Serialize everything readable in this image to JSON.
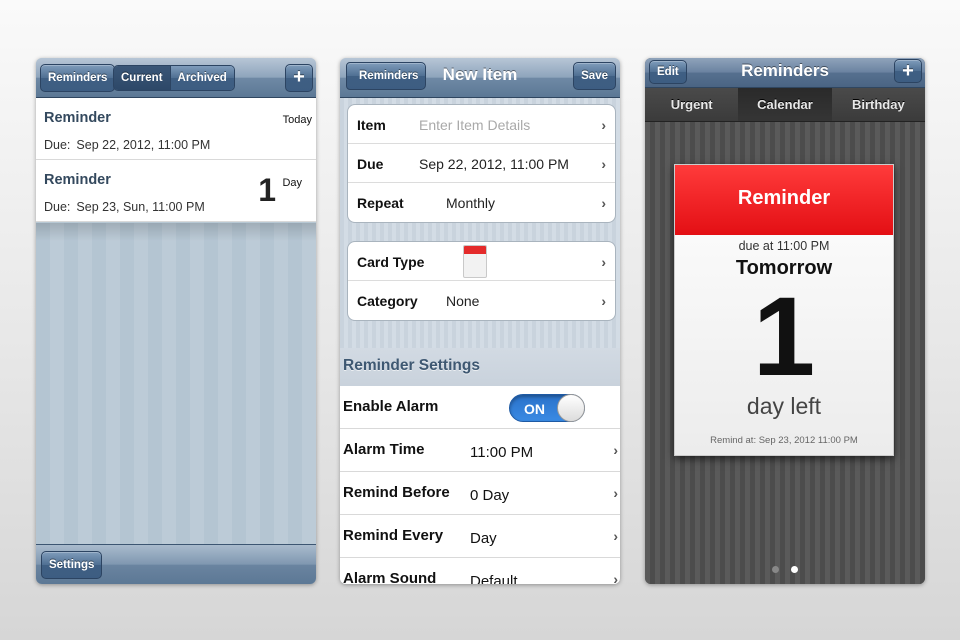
{
  "screen1": {
    "nav": {
      "back_label": "Reminders",
      "seg_current": "Current",
      "seg_archived": "Archived",
      "add_label": "+"
    },
    "items": [
      {
        "title": "Reminder",
        "due_label": "Due:",
        "due_value": "Sep 22, 2012, 11:00 PM",
        "right_text": "Today"
      },
      {
        "title": "Reminder",
        "due_label": "Due:",
        "due_value": "Sep 23, Sun, 11:00 PM",
        "count": "1",
        "unit": "Day"
      }
    ],
    "toolbar": {
      "settings_label": "Settings"
    }
  },
  "screen2": {
    "nav": {
      "back_label": "Reminders",
      "title": "New Item",
      "save_label": "Save"
    },
    "group1": [
      {
        "label": "Item",
        "placeholder": "Enter Item Details"
      },
      {
        "label": "Due",
        "value": "Sep 22, 2012, 11:00 PM"
      },
      {
        "label": "Repeat",
        "value": "Monthly"
      }
    ],
    "group2": [
      {
        "label": "Card Type"
      },
      {
        "label": "Category",
        "value": "None"
      }
    ],
    "section_title": "Reminder Settings",
    "settings": [
      {
        "label": "Enable Alarm",
        "toggle_text": "ON"
      },
      {
        "label": "Alarm Time",
        "value": "11:00 PM"
      },
      {
        "label": "Remind Before",
        "value": "0 Day"
      },
      {
        "label": "Remind Every",
        "value": "Day"
      },
      {
        "label": "Alarm Sound",
        "value": "Default"
      }
    ],
    "chevron": "›",
    "colors": {
      "toggle_on": "#2a72c9"
    }
  },
  "screen3": {
    "nav": {
      "edit_label": "Edit",
      "title": "Reminders",
      "add_label": "+"
    },
    "tabs": [
      "Urgent",
      "Calendar",
      "Birthday"
    ],
    "card": {
      "header": "Reminder",
      "due_at": "due at 11:00 PM",
      "day_word": "Tomorrow",
      "number": "1",
      "day_left": "day left",
      "remind_at": "Remind at: Sep 23, 2012 11:00 PM"
    },
    "colors": {
      "card_header": "#e30f14"
    },
    "page_indicator": {
      "pages": 2,
      "current": 2
    }
  }
}
